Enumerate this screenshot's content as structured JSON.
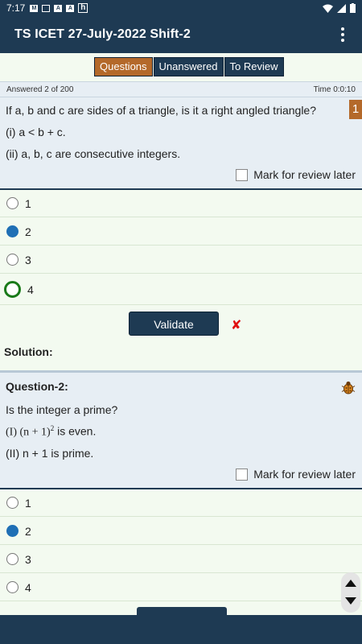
{
  "status": {
    "time": "7:17",
    "icons": [
      "M",
      "image",
      "A",
      "A",
      "h"
    ]
  },
  "app": {
    "title": "TS ICET 27-July-2022 Shift-2"
  },
  "tabs": [
    {
      "label": "Questions",
      "active": true
    },
    {
      "label": "Unanswered"
    },
    {
      "label": "To Review"
    }
  ],
  "info": {
    "answered": "Answered 2 of 200",
    "time": "Time 0:0:10"
  },
  "q1": {
    "badge": "1",
    "text": "If a, b and c are sides of a triangle, is it a right angled triangle?",
    "stmt1": "(i) a < b + c.",
    "stmt2": "(ii) a, b, c are consecutive integers.",
    "mark": "Mark for review later",
    "options": [
      "1",
      "2",
      "3",
      "4"
    ],
    "validate": "Validate",
    "result_icon": "✘",
    "solution": "Solution:"
  },
  "q2": {
    "header": "Question-2:",
    "text": "Is the integer a prime?",
    "stmt1_pre": "(I) (n + 1)",
    "stmt1_sup": "2",
    "stmt1_post": " is even.",
    "stmt2": "(II) n + 1 is prime.",
    "mark": "Mark for review later",
    "options": [
      "1",
      "2",
      "3",
      "4"
    ]
  }
}
